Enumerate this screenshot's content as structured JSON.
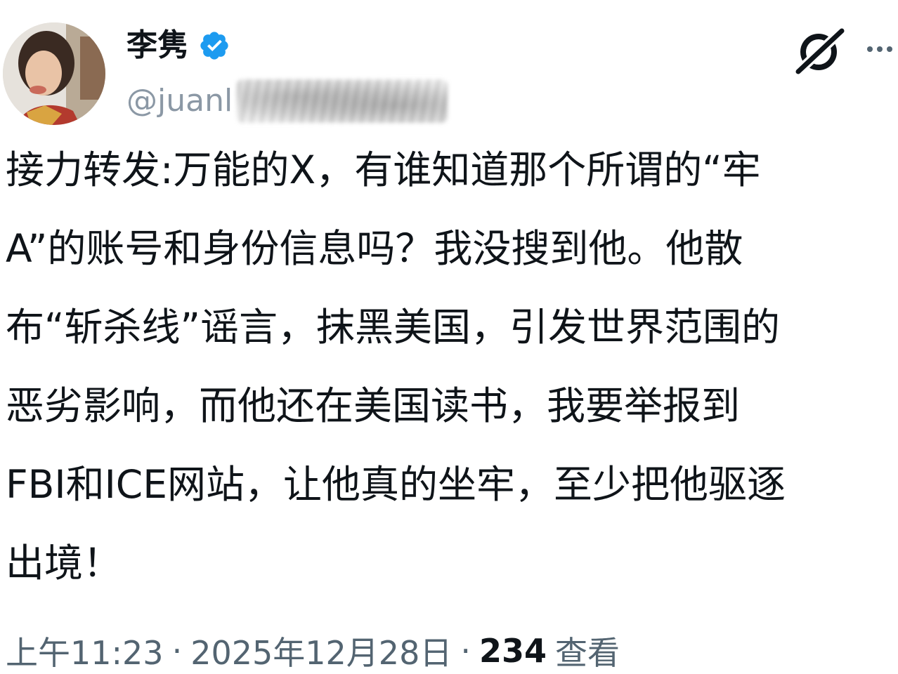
{
  "author": {
    "display_name": "李隽",
    "handle": "@juanl",
    "verified": true,
    "verified_color": "#1d9bf0"
  },
  "header_actions": {
    "grok_icon": "grok-icon",
    "more_icon": "more-icon"
  },
  "tweet": {
    "lines": [
      "接力转发:万能的X，有谁知道那个所谓的“牢",
      "A”的账号和身份信息吗？我没搜到他。他散",
      "布“斩杀线”谣言，抹黑美国，引发世界范围的",
      "恶劣影响，而他还在美国读书，我要举报到",
      "FBI和ICE网站，让他真的坐牢，至少把他驱逐",
      "出境！"
    ]
  },
  "meta": {
    "time": "上午11:23",
    "separator": "·",
    "date": "2025年12月28日",
    "views_count": "234",
    "views_label": "查看"
  },
  "colors": {
    "text": "#0f1419",
    "secondary": "#536471",
    "handle": "#8b98a5"
  }
}
